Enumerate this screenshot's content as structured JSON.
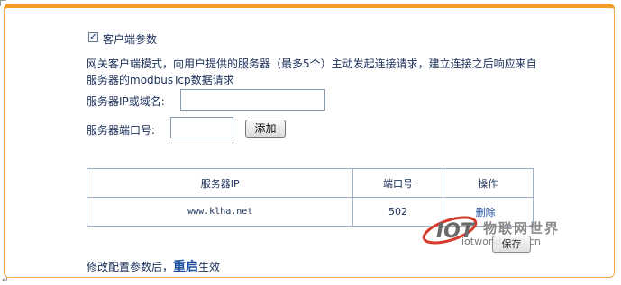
{
  "client_section": {
    "checkbox_label": "客户端参数",
    "checked": true,
    "description_line1": "网关客户端模式，向用户提供的服务器（最多5个）主动发起连接请求，建立连接之后响应来自",
    "description_line2": "服务器的modbusTcp数据请求",
    "server_ip_label": "服务器IP或域名:",
    "server_ip_value": "",
    "server_port_label": "服务器端口号:",
    "server_port_value": "",
    "add_button": "添加"
  },
  "table": {
    "headers": [
      "服务器IP",
      "端口号",
      "操作"
    ],
    "rows": [
      {
        "ip": "www.klha.net",
        "port": "502",
        "action": "删除"
      }
    ]
  },
  "save_button": "保存",
  "footer": {
    "prefix": "修改配置参数后，",
    "emphasis": "重启",
    "suffix": "生效"
  },
  "watermark": {
    "logo_text": "IOT",
    "title": "物联网世界",
    "url": "iotworld.com.cn"
  },
  "colors": {
    "panel_border": "#f39c28",
    "text": "#1a2f5a",
    "link": "#1f4fa0",
    "watermark_red": "#d63a2a"
  }
}
